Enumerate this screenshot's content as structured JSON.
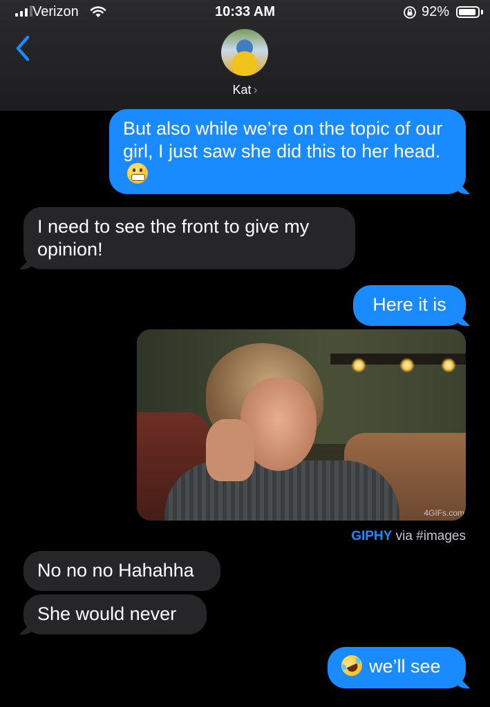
{
  "status_bar": {
    "carrier": "Verizon",
    "time": "10:33 AM",
    "battery": "92%",
    "battery_level": 0.92
  },
  "header": {
    "contact_name": "Kat",
    "contact_chevron": "›",
    "back_icon": "chevron-left-icon"
  },
  "messages": [
    {
      "from": "me",
      "text": "But also while we’re on the topic of our girl, I just saw she did this to her head.",
      "emoji": "grimacing-face"
    },
    {
      "from": "them",
      "text": "I need to see the front to give my opinion!"
    },
    {
      "from": "me",
      "text": "Here it is"
    },
    {
      "from": "me",
      "type": "gif",
      "watermark": "4GIFs.com",
      "source_brand": "GIPHY",
      "source_via": "via #images"
    },
    {
      "from": "them",
      "text": "No no no Hahahha"
    },
    {
      "from": "them",
      "text": "She would never"
    },
    {
      "from": "me",
      "text": "we’ll see",
      "emoji": "rolling-on-floor-laughing"
    }
  ],
  "colors": {
    "sent_bubble": "#1a8aff",
    "received_bubble": "#262628",
    "background": "#000000",
    "accent": "#1a8aff"
  }
}
